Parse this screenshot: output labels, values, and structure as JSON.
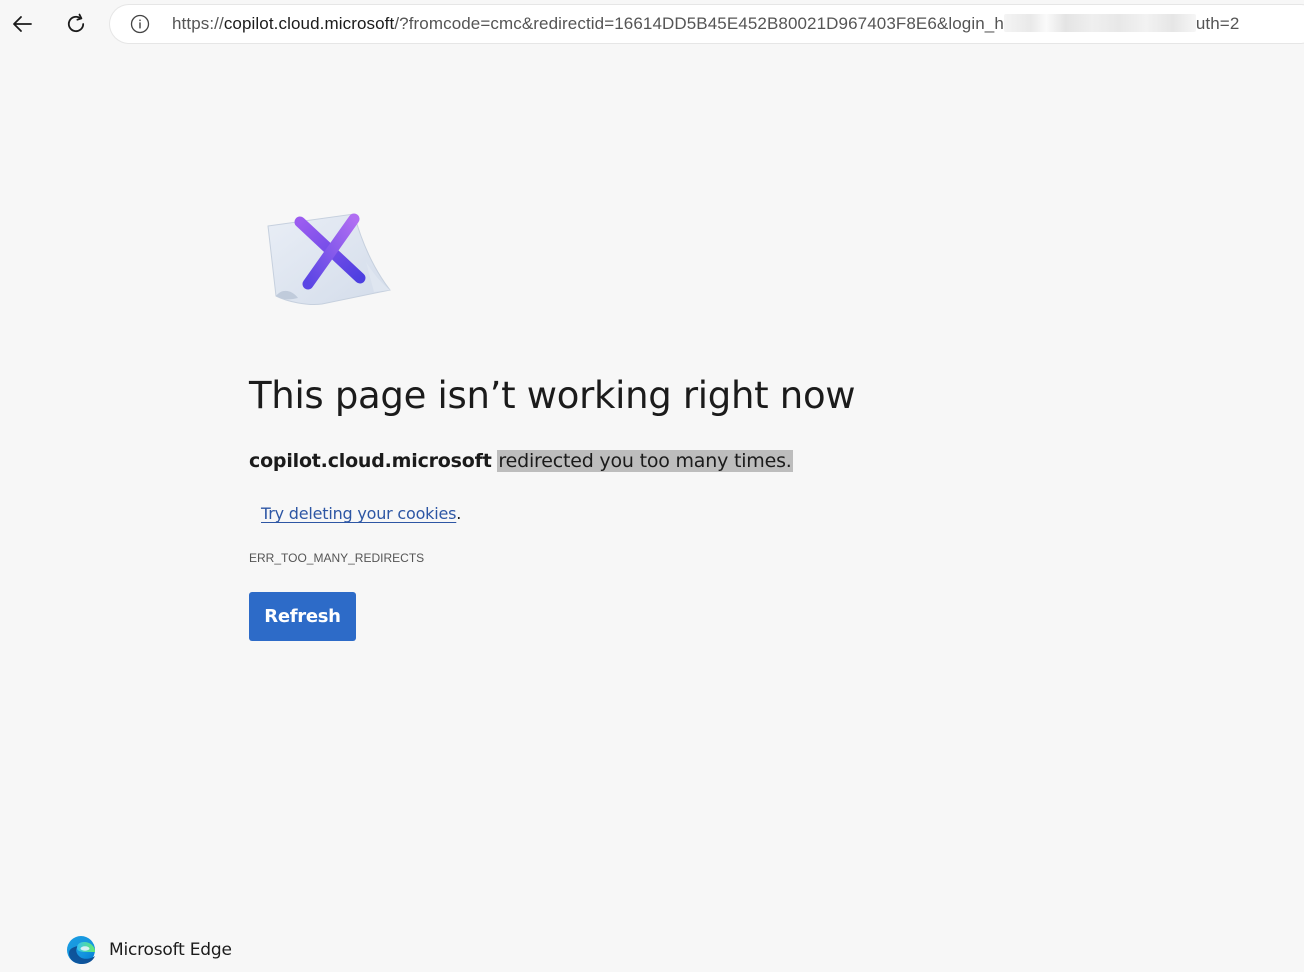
{
  "browser": {
    "back_icon": "arrow-left-icon",
    "reload_icon": "refresh-icon",
    "site_info_icon": "info-circle-icon",
    "url": {
      "scheme": "https://",
      "host": "copilot.cloud.microsoft",
      "path_visible": "/?fromcode=cmc&redirectid=16614DD5B45E452B80021D967403F8E6&login_h",
      "tail_visible": "uth=2"
    }
  },
  "error_page": {
    "headline": "This page isn’t working right now",
    "host": "copilot.cloud.microsoft",
    "message": "redirected you too many times.",
    "suggestion_link": "Try deleting your cookies",
    "suggestion_suffix": ".",
    "error_code": "ERR_TOO_MANY_REDIRECTS",
    "refresh_label": "Refresh",
    "illustration_icon": "broken-page-x-icon"
  },
  "footer": {
    "logo_icon": "microsoft-edge-icon",
    "brand_label": "Microsoft Edge"
  },
  "colors": {
    "page_background": "#f7f7f7",
    "button_blue": "#2d6bc8",
    "link_blue": "#2d56a4",
    "selection_gray": "#bdbdbd",
    "x_purple": "#7a4ee6"
  }
}
